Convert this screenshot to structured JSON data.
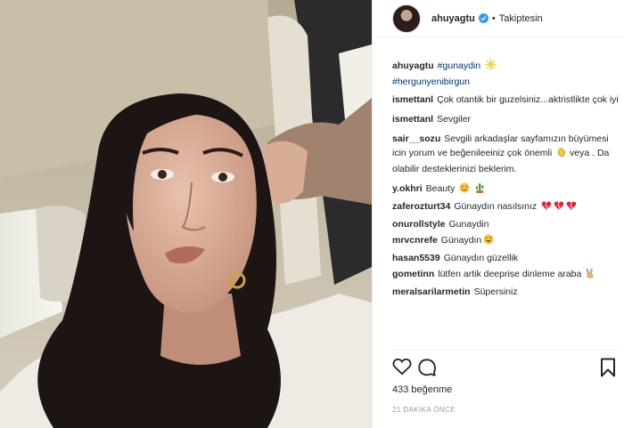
{
  "post": {
    "author": "ahuyagtu",
    "separator": "•",
    "follow_label": "Takiptesin",
    "caption": {
      "user": "ahuyagtu",
      "hashtag1": "#gunaydin",
      "hashtag2": "#hergunyenibirgun",
      "emoji": "sun-emoji"
    },
    "comments": [
      {
        "user": "ismettanl",
        "text": "Çok otantik bir guzelsiniz...aktristlikte çok iyi"
      },
      {
        "user": "ismettanl",
        "text": "Sevgiler"
      },
      {
        "user": "sair__sozu",
        "text": "Sevgili arkadaşlar sayfamızın büyümesi icin yorum ve beğenileeiniz çok önemli",
        "text2": "veya . Da olabilir desteklerinizi beklerim.",
        "emoji": "clap-emoji"
      },
      {
        "user": "y.okhri",
        "text": "Beauty",
        "emoji": "heart-eyes-and-cactus-emoji"
      },
      {
        "user": "zaferozturt34",
        "text": "Günaydın nasılsınız",
        "emoji": "broken-hearts-emoji"
      },
      {
        "user": "onurollstyle",
        "text": "Gunaydin"
      },
      {
        "user": "mrvcnrefe",
        "text": "Günaydın",
        "emoji": "laughing-emoji"
      },
      {
        "user": "hasan5539",
        "text": "Günaydın güzellik"
      },
      {
        "user": "gometinn",
        "text": "lütfen artik deeprise dinleme araba",
        "emoji": "victory-hand-emoji"
      },
      {
        "user": "meralsarilarmetin",
        "text": "Süpersiniz"
      }
    ],
    "likes": "433 beğenme",
    "timestamp": "21 DAKİKA ÖNCE"
  },
  "icons": {
    "like": "heart-icon",
    "comment": "comment-icon",
    "save": "bookmark-icon",
    "verified": "verified-badge-icon"
  },
  "colors": {
    "verified": "#3897f0",
    "hashtag": "#003569",
    "muted": "#999999"
  }
}
